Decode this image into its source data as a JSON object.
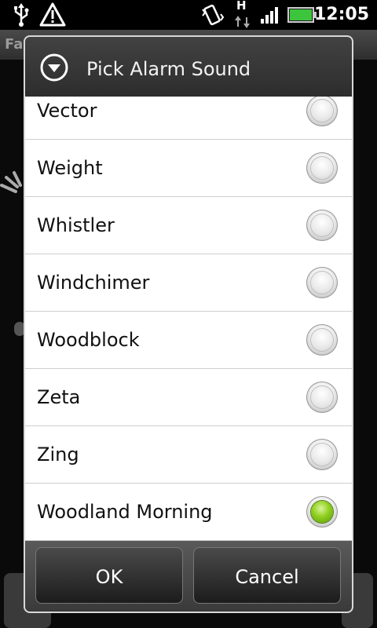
{
  "status_bar": {
    "time": "12:05",
    "network": "H",
    "icons": [
      "usb-icon",
      "warning-icon",
      "vibrate-icon",
      "data-arrows-icon",
      "signal-icon",
      "battery-icon"
    ]
  },
  "background_app": {
    "title": "Fa"
  },
  "dialog": {
    "title": "Pick Alarm Sound",
    "icon": "chevron-down-circle-icon",
    "items": [
      {
        "label": "Vector",
        "checked": false
      },
      {
        "label": "Weight",
        "checked": false
      },
      {
        "label": "Whistler",
        "checked": false
      },
      {
        "label": "Windchimer",
        "checked": false
      },
      {
        "label": "Woodblock",
        "checked": false
      },
      {
        "label": "Zeta",
        "checked": false
      },
      {
        "label": "Zing",
        "checked": false
      },
      {
        "label": "Woodland Morning",
        "checked": true
      }
    ],
    "ok_label": "OK",
    "cancel_label": "Cancel"
  },
  "colors": {
    "accent_selected": "#8fcf1f",
    "header_bg": "#3a3a3a",
    "battery_green": "#3cc43c"
  }
}
